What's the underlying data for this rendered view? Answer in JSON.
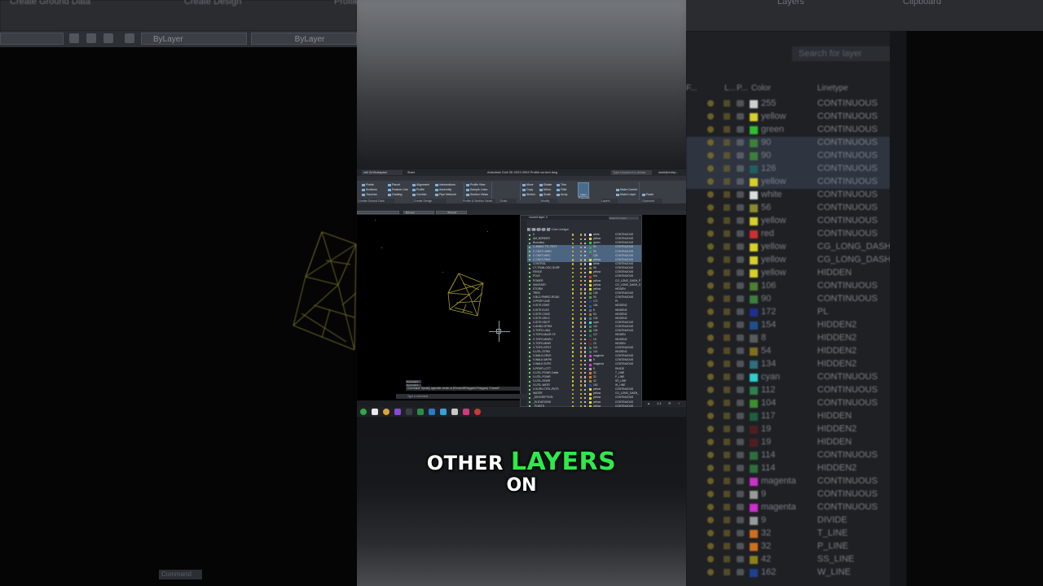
{
  "background": {
    "left_menu": [
      "Create Ground Data",
      "Create Design",
      "Profile"
    ],
    "left_layer_select": "ByLayer",
    "left_linetype_select": "ByLayer",
    "left_command": "Command",
    "right_menu": [
      "Layers",
      "Clipboard"
    ],
    "right_search": "Search for layer",
    "right_headers": [
      "F...",
      "L...",
      "P...",
      "Color",
      "Linetype"
    ],
    "right_rows": [
      {
        "color_name": "255",
        "color_hex": "#cfcfcf",
        "linetype": "CONTINUOUS"
      },
      {
        "color_name": "yellow",
        "color_hex": "#d7cf2b",
        "linetype": "CONTINUOUS"
      },
      {
        "color_name": "green",
        "color_hex": "#2fbf2f",
        "linetype": "CONTINUOUS"
      },
      {
        "color_name": "90",
        "color_hex": "#3d7f3d",
        "linetype": "CONTINUOUS"
      },
      {
        "color_name": "90",
        "color_hex": "#3d7f3d",
        "linetype": "CONTINUOUS"
      },
      {
        "color_name": "126",
        "color_hex": "#1f5f5f",
        "linetype": "CONTINUOUS"
      },
      {
        "color_name": "yellow",
        "color_hex": "#d7cf2b",
        "linetype": "CONTINUOUS"
      },
      {
        "color_name": "white",
        "color_hex": "#dddddd",
        "linetype": "CONTINUOUS"
      },
      {
        "color_name": "56",
        "color_hex": "#8a8a2a",
        "linetype": "CONTINUOUS"
      },
      {
        "color_name": "yellow",
        "color_hex": "#d7cf2b",
        "linetype": "CONTINUOUS"
      },
      {
        "color_name": "red",
        "color_hex": "#cf2f2f",
        "linetype": "CONTINUOUS"
      },
      {
        "color_name": "yellow",
        "color_hex": "#d7cf2b",
        "linetype": "CG_LONG_DASH_P"
      },
      {
        "color_name": "yellow",
        "color_hex": "#d7cf2b",
        "linetype": "CG_LONG_DASH_S"
      },
      {
        "color_name": "yellow",
        "color_hex": "#d7cf2b",
        "linetype": "HIDDEN"
      },
      {
        "color_name": "106",
        "color_hex": "#4f7f2f",
        "linetype": "CONTINUOUS"
      },
      {
        "color_name": "90",
        "color_hex": "#3d7f3d",
        "linetype": "CONTINUOUS"
      },
      {
        "color_name": "172",
        "color_hex": "#1f2f8f",
        "linetype": "PL"
      },
      {
        "color_name": "154",
        "color_hex": "#1f4f8f",
        "linetype": "HIDDEN2"
      },
      {
        "color_name": "8",
        "color_hex": "#5a5a5a",
        "linetype": "HIDDEN2"
      },
      {
        "color_name": "54",
        "color_hex": "#7f6f1f",
        "linetype": "HIDDEN2"
      },
      {
        "color_name": "134",
        "color_hex": "#2f6f7f",
        "linetype": "HIDDEN2"
      },
      {
        "color_name": "cyan",
        "color_hex": "#2fcfcf",
        "linetype": "CONTINUOUS"
      },
      {
        "color_name": "112",
        "color_hex": "#2f7f4f",
        "linetype": "CONTINUOUS"
      },
      {
        "color_name": "104",
        "color_hex": "#3f8f2f",
        "linetype": "CONTINUOUS"
      },
      {
        "color_name": "117",
        "color_hex": "#1f5f3f",
        "linetype": "HIDDEN"
      },
      {
        "color_name": "19",
        "color_hex": "#4f1f1f",
        "linetype": "HIDDEN2"
      },
      {
        "color_name": "19",
        "color_hex": "#4f1f1f",
        "linetype": "HIDDEN"
      },
      {
        "color_name": "114",
        "color_hex": "#2f6f3f",
        "linetype": "CONTINUOUS"
      },
      {
        "color_name": "114",
        "color_hex": "#2f6f3f",
        "linetype": "HIDDEN2"
      },
      {
        "color_name": "magenta",
        "color_hex": "#cf2fcf",
        "linetype": "CONTINUOUS"
      },
      {
        "color_name": "9",
        "color_hex": "#9a9a9a",
        "linetype": "CONTINUOUS"
      },
      {
        "color_name": "magenta",
        "color_hex": "#cf2fcf",
        "linetype": "CONTINUOUS"
      },
      {
        "color_name": "9",
        "color_hex": "#9a9a9a",
        "linetype": "DIVIDE"
      },
      {
        "color_name": "32",
        "color_hex": "#cf6f1f",
        "linetype": "T_LINE"
      },
      {
        "color_name": "32",
        "color_hex": "#cf6f1f",
        "linetype": "P_LINE"
      },
      {
        "color_name": "42",
        "color_hex": "#8f7f1f",
        "linetype": "SS_LINE"
      },
      {
        "color_name": "162",
        "color_hex": "#1f3f8f",
        "linetype": "W_LINE"
      }
    ]
  },
  "app": {
    "doc_tab": "civil 3d Workspace",
    "share": "Share",
    "title": "Autodesk Civil 3D 2023   2003 Profile current.dwg",
    "search": "Type a keyword or phrase",
    "user": "david@civilsp...",
    "menus": [
      "Home",
      "Insert",
      "Annotate",
      "Modify",
      "Analyze",
      "View",
      "Manage",
      "Output",
      "Survey",
      "Rail",
      "Transparent",
      "InfraWorks",
      "Collaborate",
      "Help",
      "BIM 360",
      "Express Tools",
      "Geotechnical Modeler",
      "Featured Apps"
    ],
    "ribbon_items": {
      "ground": [
        "Points",
        "Surfaces",
        "Traverse"
      ],
      "parcel": [
        "Parcel",
        "Feature Line",
        "Grading"
      ],
      "design": [
        "Alignment",
        "Profile",
        "Corridor"
      ],
      "intersect": [
        "Intersections",
        "Assembly",
        "Pipe Network"
      ],
      "profile": [
        "Profile View",
        "Sample Lines",
        "Section Views"
      ],
      "modify": [
        "Move",
        "Copy",
        "Stretch",
        "Rotate",
        "Mirror",
        "Scale",
        "Trim",
        "Fillet",
        "Array"
      ],
      "layer_btn": "Layer Properties",
      "layers": [
        "Make Current",
        "Match Layer"
      ],
      "paste": "Paste"
    },
    "ribbon_groups": [
      "Create Ground Data",
      "Create Design",
      "Profile & Section Views",
      "Draw",
      "Modify",
      "Layers",
      "Clipboard"
    ],
    "prop_layer": "ByLayer",
    "prop_linetype": "ByLayer",
    "cmd_history": [
      "Command:",
      "Command:"
    ],
    "cmd_text": "Command: Specify opposite corner or [Fence/WPolygon/CPolygon]: *Cancel*",
    "cmd_input": "Type a command",
    "zoom": "1:1"
  },
  "layer_panel": {
    "title": "Current layer: 0",
    "search": "Search for layer",
    "headers": "S.. Name                    On  Fr  L  P  Color       Linetype",
    "rows": [
      {
        "name": "0",
        "color": "white",
        "hex": "#eeeeee",
        "lt": "CONTINUOUS",
        "sel": false
      },
      {
        "name": "AM_BORDER",
        "color": "yellow",
        "hex": "#e6d635",
        "lt": "CONTINUOUS",
        "sel": false
      },
      {
        "name": "Boundary",
        "color": "green",
        "hex": "#33cc33",
        "lt": "CONTINUOUS",
        "sel": false
      },
      {
        "name": "C-ANNO-TTL-TEXT",
        "color": "90",
        "hex": "#4c994c",
        "lt": "CONTINUOUS",
        "sel": true
      },
      {
        "name": "C-CNST-HARD",
        "color": "90",
        "hex": "#4c994c",
        "lt": "CONTINUOUS",
        "sel": true
      },
      {
        "name": "C-CNST-MISC",
        "color": "126",
        "hex": "#2a6a6a",
        "lt": "CONTINUOUS",
        "sel": true
      },
      {
        "name": "C-CNST-PAVE",
        "color": "yellow",
        "hex": "#e6d635",
        "lt": "CONTINUOUS",
        "sel": true
      },
      {
        "name": "CONTROL",
        "color": "white",
        "hex": "#eeeeee",
        "lt": "CONTINUOUS",
        "sel": false
      },
      {
        "name": "CT-TRAN-OGC-SURF",
        "color": "56",
        "hex": "#8a8a2a",
        "lt": "CONTINUOUS",
        "sel": false
      },
      {
        "name": "FENCE",
        "color": "yellow",
        "hex": "#e6d635",
        "lt": "CONTINUOUS",
        "sel": false
      },
      {
        "name": "POLE",
        "color": "red",
        "hex": "#dd3333",
        "lt": "CONTINUOUS",
        "sel": false
      },
      {
        "name": "POWER",
        "color": "yellow",
        "hex": "#e6d635",
        "lt": "CG_LONG_DASH_P",
        "sel": false
      },
      {
        "name": "SANITARY",
        "color": "yellow",
        "hex": "#e6d635",
        "lt": "CG_LONG_DASH_S",
        "sel": false
      },
      {
        "name": "STORM",
        "color": "yellow",
        "hex": "#e6d635",
        "lt": "HIDDEN",
        "sel": false
      },
      {
        "name": "TREE",
        "color": "106",
        "hex": "#5a8f33",
        "lt": "CONTINUOUS",
        "sel": false
      },
      {
        "name": "V-BLD-PARKD-ROAD",
        "color": "90",
        "hex": "#4c994c",
        "lt": "CONTINUOUS",
        "sel": false
      },
      {
        "name": "V-PROP-LINE",
        "color": "172",
        "hex": "#2a3a9a",
        "lt": "PL",
        "sel": false
      },
      {
        "name": "V-SITE-ESMT",
        "color": "154",
        "hex": "#2a5a9a",
        "lt": "HIDDEN2",
        "sel": false
      },
      {
        "name": "V-SITE-ELEC",
        "color": "8",
        "hex": "#666666",
        "lt": "HIDDEN2",
        "sel": false
      },
      {
        "name": "V-SITE-CONC",
        "color": "54",
        "hex": "#8a7a2a",
        "lt": "HIDDEN2",
        "sel": false
      },
      {
        "name": "V-SITE-GRLS",
        "color": "134",
        "hex": "#3a7a8a",
        "lt": "HIDDEN2",
        "sel": false
      },
      {
        "name": "V-SITE-HDCP",
        "color": "cyan",
        "hex": "#33dddd",
        "lt": "CONTINUOUS",
        "sel": false
      },
      {
        "name": "V-ANNO-STRM",
        "color": "112",
        "hex": "#3a8a5a",
        "lt": "CONTINUOUS",
        "sel": false
      },
      {
        "name": "V-TOPO-LABL",
        "color": "104",
        "hex": "#4a9a3a",
        "lt": "CONTINUOUS",
        "sel": false
      },
      {
        "name": "V-TOPO-MAJR-TE",
        "color": "117",
        "hex": "#2a6a4a",
        "lt": "HIDDEN",
        "sel": false
      },
      {
        "name": "V-TOPO-MINR-I",
        "color": "19",
        "hex": "#6a2a2a",
        "lt": "HIDDEN2",
        "sel": false
      },
      {
        "name": "V-TOPO-MINR",
        "color": "19",
        "hex": "#6a2a2a",
        "lt": "HIDDEN",
        "sel": false
      },
      {
        "name": "V-TOPO-SPOT",
        "color": "114",
        "hex": "#3a7a4a",
        "lt": "CONTINUOUS",
        "sel": false
      },
      {
        "name": "V-UTIL-STRM",
        "color": "114",
        "hex": "#3a7a4a",
        "lt": "HIDDEN2",
        "sel": false
      },
      {
        "name": "V-WALK-DRVE",
        "color": "magenta",
        "hex": "#dd33dd",
        "lt": "CONTINUOUS",
        "sel": false
      },
      {
        "name": "V-WALK-WKPK",
        "color": "9",
        "hex": "#aaaaaa",
        "lt": "CONTINUOUS",
        "sel": false
      },
      {
        "name": "V-WALK-SCPE",
        "color": "magenta",
        "hex": "#dd33dd",
        "lt": "CONTINUOUS",
        "sel": false
      },
      {
        "name": "V-PROP-LOTT",
        "color": "9",
        "hex": "#aaaaaa",
        "lt": "DIVIDE",
        "sel": false
      },
      {
        "name": "V-UTIL-POWR-Cable",
        "color": "32",
        "hex": "#dd7a2a",
        "lt": "T_LINE",
        "sel": false
      },
      {
        "name": "V-UTIL-POWR",
        "color": "32",
        "hex": "#dd7a2a",
        "lt": "P_LINE",
        "sel": false
      },
      {
        "name": "V-UTIL-SSWR",
        "color": "42",
        "hex": "#9a8a2a",
        "lt": "SS_LINE",
        "sel": false
      },
      {
        "name": "V-UTIL-WATR",
        "color": "162",
        "hex": "#2a4a9a",
        "lt": "W_LINE",
        "sel": false
      },
      {
        "name": "V-SURV-CTRL-PNTS",
        "color": "yellow",
        "hex": "#e6d635",
        "lt": "CONTINUOUS",
        "sel": false
      },
      {
        "name": "WATER",
        "color": "yellow",
        "hex": "#e6d635",
        "lt": "CG_LONG_DASH_",
        "sel": false
      },
      {
        "name": "_DESCRIPTION",
        "color": "yellow",
        "hex": "#e6d635",
        "lt": "CONTINUOUS",
        "sel": false
      },
      {
        "name": "_ELEVATIONS",
        "color": "yellow",
        "hex": "#e6d635",
        "lt": "CONTINUOUS",
        "sel": false
      },
      {
        "name": "_POINTS",
        "color": "yellow",
        "hex": "#e6d635",
        "lt": "CONTINUOUS",
        "sel": false
      }
    ]
  },
  "caption": {
    "line1_word1": "OTHER",
    "line1_word2": "LAYERS",
    "line2": "ON",
    "accent_color": "#2fe84a"
  }
}
